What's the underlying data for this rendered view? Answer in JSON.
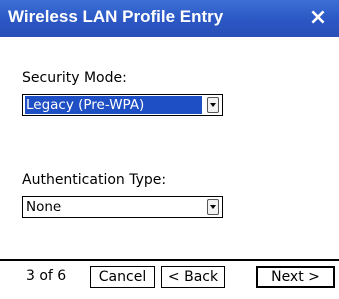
{
  "window": {
    "title": "Wireless LAN Profile Entry",
    "close_label": "×"
  },
  "security": {
    "label": "Security Mode:",
    "value": "Legacy (Pre-WPA)"
  },
  "authentication": {
    "label": "Authentication Type:",
    "value": "None"
  },
  "footer": {
    "page_count": "3 of 6",
    "cancel_label": "Cancel",
    "back_label": "< Back",
    "next_label": "Next >"
  },
  "icons": {
    "close": "close-icon",
    "dropdown": "dropdown-arrow-icon"
  },
  "colors": {
    "titlebar": "#2b57c4",
    "selection": "#1f4fc4"
  }
}
